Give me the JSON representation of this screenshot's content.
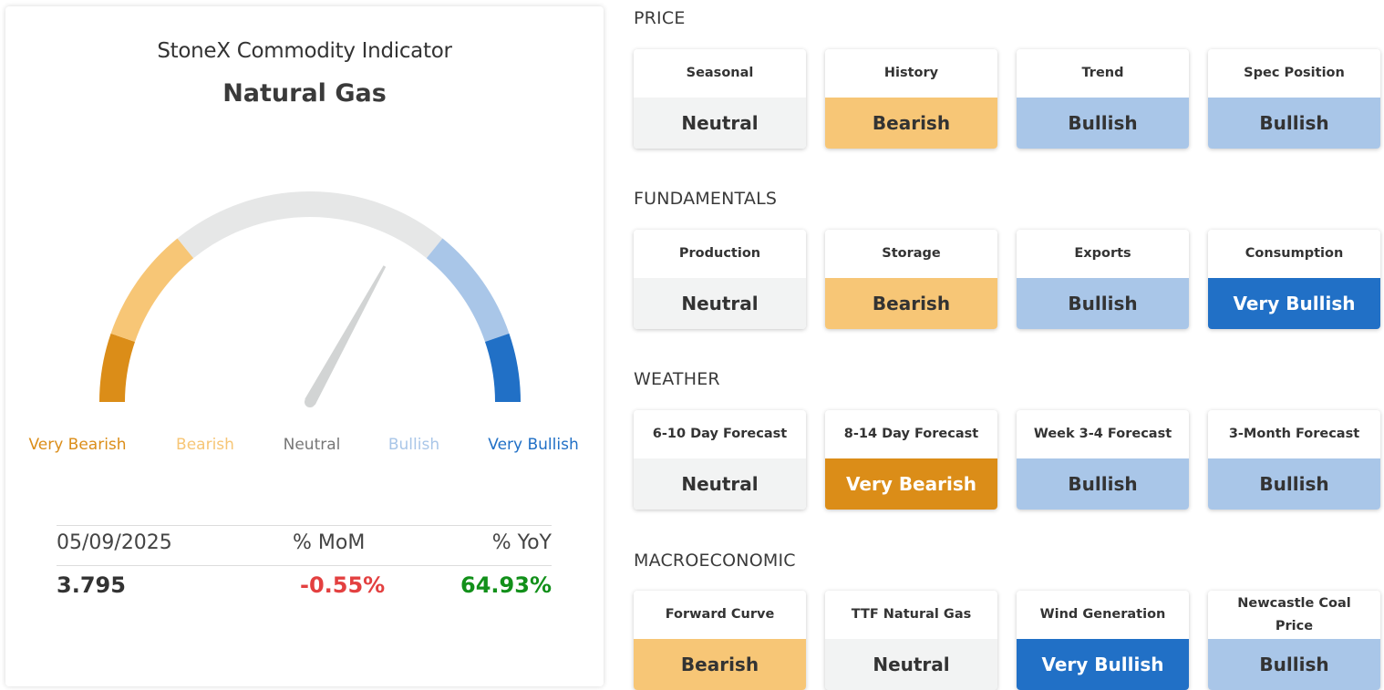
{
  "indicator": {
    "title": "StoneX Commodity Indicator",
    "commodity": "Natural Gas",
    "gauge": {
      "needle_value": 0.66,
      "labels": [
        "Very Bearish",
        "Bearish",
        "Neutral",
        "Bullish",
        "Very Bullish"
      ],
      "colors": {
        "very_bearish": "#db8d18",
        "bearish": "#f7c676",
        "neutral": "#e6e7e7",
        "bullish": "#a9c6e8",
        "very_bullish": "#2170c6",
        "needle": "#d2d4d4"
      }
    },
    "stats": {
      "date": "05/09/2025",
      "mom_label": "% MoM",
      "yoy_label": "% YoY",
      "price": "3.795",
      "mom": "-0.55%",
      "yoy": "64.93%",
      "mom_color": "#e34040",
      "yoy_color": "#12901a"
    }
  },
  "sections": [
    {
      "title": "PRICE",
      "tiles": [
        {
          "label": "Seasonal",
          "value": "Neutral"
        },
        {
          "label": "History",
          "value": "Bearish"
        },
        {
          "label": "Trend",
          "value": "Bullish"
        },
        {
          "label": "Spec Position",
          "value": "Bullish"
        }
      ]
    },
    {
      "title": "FUNDAMENTALS",
      "tiles": [
        {
          "label": "Production",
          "value": "Neutral"
        },
        {
          "label": "Storage",
          "value": "Bearish"
        },
        {
          "label": "Exports",
          "value": "Bullish"
        },
        {
          "label": "Consumption",
          "value": "Very Bullish"
        }
      ]
    },
    {
      "title": "WEATHER",
      "tiles": [
        {
          "label": "6-10 Day Forecast",
          "value": "Neutral"
        },
        {
          "label": "8-14 Day Forecast",
          "value": "Very Bearish"
        },
        {
          "label": "Week 3-4 Forecast",
          "value": "Bullish"
        },
        {
          "label": "3-Month Forecast",
          "value": "Bullish"
        }
      ]
    },
    {
      "title": "MACROECONOMIC",
      "tiles": [
        {
          "label": "Forward Curve",
          "value": "Bearish"
        },
        {
          "label": "TTF Natural Gas",
          "value": "Neutral"
        },
        {
          "label": "Wind Generation",
          "value": "Very Bullish"
        },
        {
          "label": "Newcastle Coal Price",
          "value": "Bullish"
        }
      ]
    }
  ]
}
